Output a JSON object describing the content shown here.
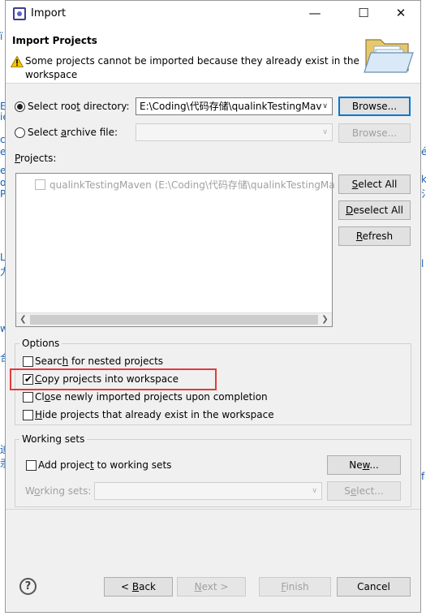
{
  "window": {
    "title": "Import",
    "minimize": "—",
    "maximize": "☐",
    "close": "✕"
  },
  "header": {
    "title": "Import Projects",
    "message": "Some projects cannot be imported because they already exist in the workspace"
  },
  "source": {
    "root_dir_label_pre": "Select roo",
    "root_dir_label_u": "t",
    "root_dir_label_post": " directory:",
    "root_dir_value": "E:\\Coding\\代码存储\\qualinkTestingMav",
    "browse_root_label": "Browse...",
    "archive_label_pre": "Select ",
    "archive_label_u": "a",
    "archive_label_post": "rchive file:",
    "browse_archive_label": "Browse..."
  },
  "projects": {
    "label_pre": "",
    "label_u": "P",
    "label_post": "rojects:",
    "items": [
      {
        "label": "qualinkTestingMaven (E:\\Coding\\代码存储\\qualinkTestingMa"
      }
    ],
    "select_all_pre": "",
    "select_all_u": "S",
    "select_all_post": "elect All",
    "deselect_all_pre": "",
    "deselect_all_u": "D",
    "deselect_all_post": "eselect All",
    "refresh_pre": "",
    "refresh_u": "R",
    "refresh_post": "efresh"
  },
  "options": {
    "title": "Options",
    "nested_pre": "Searc",
    "nested_u": "h",
    "nested_post": " for nested projects",
    "copy_pre": "",
    "copy_u": "C",
    "copy_post": "opy projects into workspace",
    "close_pre": "Cl",
    "close_u": "o",
    "close_post": "se newly imported projects upon completion",
    "hide_pre": "",
    "hide_u": "H",
    "hide_post": "ide projects that already exist in the workspace"
  },
  "working_sets": {
    "title": "Working sets",
    "add_pre": "Add projec",
    "add_u": "t",
    "add_post": " to working sets",
    "new_pre": "Ne",
    "new_u": "w",
    "new_post": "...",
    "sets_pre": "W",
    "sets_u": "o",
    "sets_post": "rking sets:",
    "select_pre": "S",
    "select_u": "e",
    "select_post": "lect..."
  },
  "footer": {
    "help": "?",
    "back_pre": "< ",
    "back_u": "B",
    "back_post": "ack",
    "next_pre": "",
    "next_u": "N",
    "next_post": "ext >",
    "finish_pre": "",
    "finish_u": "F",
    "finish_post": "inish",
    "cancel": "Cancel"
  },
  "background": {
    "left_fragments": [
      "ï",
      "E",
      "ie",
      "ce",
      "er",
      "er",
      "Pa",
      "oa",
      "L",
      "力",
      "ws",
      "合",
      "迫",
      "汞"
    ],
    "right_fragments": [
      "é",
      "k",
      "氵",
      "l",
      "f"
    ]
  },
  "colors": {
    "highlight": "#e23b3b",
    "focus": "#0078d7",
    "bg_text": "#1a5fb4"
  }
}
